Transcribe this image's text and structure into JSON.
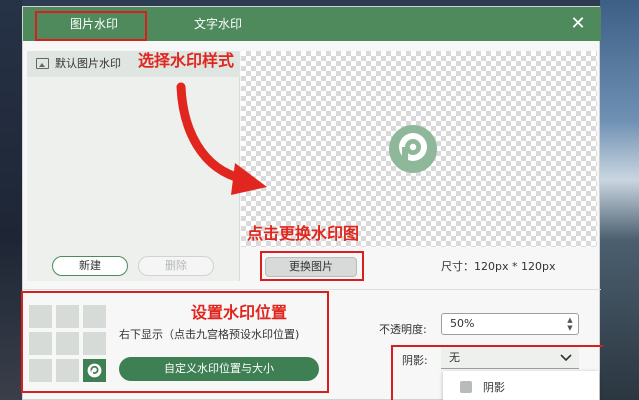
{
  "tabs": {
    "image_watermark": "图片水印",
    "text_watermark": "文字水印"
  },
  "close_glyph": "✕",
  "annotations": {
    "select_style": "选择水印样式",
    "replace_image": "点击更换水印图",
    "set_position": "设置水印位置"
  },
  "watermark_list": {
    "default_item": "默认图片水印"
  },
  "buttons": {
    "new": "新建",
    "delete": "删除",
    "replace_image": "更换图片",
    "custom_position": "自定义水印位置与大小"
  },
  "size_text": "尺寸：120px * 120px",
  "position": {
    "label": "右下显示（点击九宫格预设水印位置)",
    "selected_cell": 9
  },
  "opacity": {
    "label": "不透明度:",
    "value": "50%"
  },
  "shadow": {
    "label": "阴影:",
    "value": "无",
    "option": "阴影"
  },
  "colors": {
    "brand": "#4e8a5c",
    "accent_dark": "#3f7f54",
    "annotation": "#e0261e"
  }
}
